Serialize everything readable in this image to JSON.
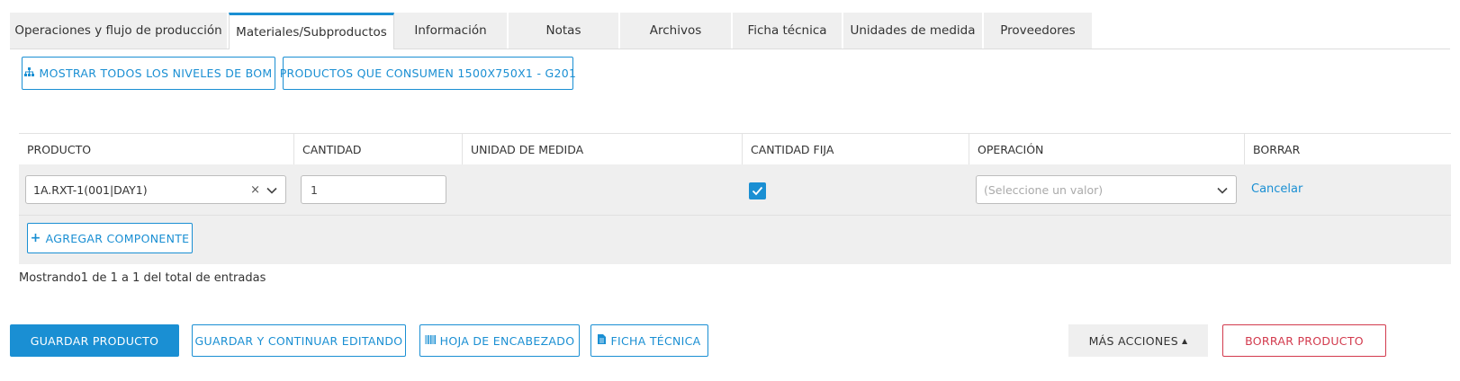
{
  "tabs": [
    {
      "label": "Operaciones y flujo de producción"
    },
    {
      "label": "Materiales/Subproductos"
    },
    {
      "label": "Información"
    },
    {
      "label": "Notas"
    },
    {
      "label": "Archivos"
    },
    {
      "label": "Ficha técnica"
    },
    {
      "label": "Unidades de medida"
    },
    {
      "label": "Proveedores"
    }
  ],
  "active_tab": "Materiales/Subproductos",
  "toolbar": {
    "show_bom_label": "MOSTRAR TODOS LOS NIVELES DE BOM",
    "consumers_label": "PRODUCTOS QUE CONSUMEN 1500X750X1 - G201"
  },
  "table": {
    "headers": [
      "PRODUCTO",
      "CANTIDAD",
      "UNIDAD DE MEDIDA",
      "CANTIDAD FIJA",
      "OPERACIÓN",
      "BORRAR"
    ],
    "row": {
      "product": "1A.RXT-1(001|DAY1)",
      "quantity": "1",
      "unit": "",
      "fixed_quantity": true,
      "operation_placeholder": "(Seleccione un valor)",
      "delete_action": "Cancelar"
    },
    "add_component_label": "AGREGAR COMPONENTE"
  },
  "entries_text": "Mostrando1 de 1 a 1 del total de entradas",
  "footer": {
    "save_label": "GUARDAR PRODUCTO",
    "save_continue_label": "GUARDAR Y CONTINUAR EDITANDO",
    "header_sheet_label": "HOJA DE ENCABEZADO",
    "tech_sheet_label": "FICHA TÉCNICA",
    "more_actions_label": "MÁS ACCIONES",
    "delete_label": "BORRAR PRODUCTO"
  },
  "colors": {
    "accent": "#1a8fd3",
    "danger": "#d23a4d",
    "row_bg": "#efefef"
  }
}
